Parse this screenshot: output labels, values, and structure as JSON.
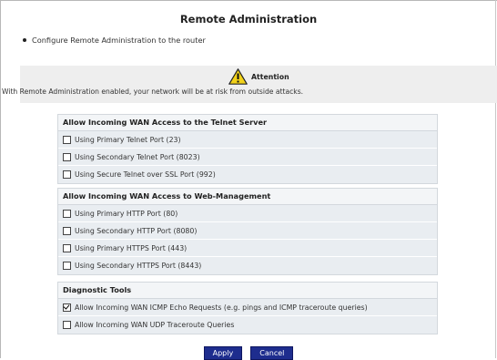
{
  "page": {
    "title": "Remote Administration",
    "intro": "Configure Remote Administration to the router"
  },
  "attention": {
    "title": "Attention",
    "message": "With Remote Administration enabled, your network will be at risk from outside attacks.",
    "icon": "warning-icon"
  },
  "sections": {
    "telnet": {
      "heading": "Allow Incoming WAN Access to the Telnet Server",
      "options": [
        {
          "label": "Using Primary Telnet Port (23)",
          "checked": false
        },
        {
          "label": "Using Secondary Telnet Port (8023)",
          "checked": false
        },
        {
          "label": "Using Secure Telnet over SSL Port (992)",
          "checked": false
        }
      ]
    },
    "web": {
      "heading": "Allow Incoming WAN Access to Web-Management",
      "options": [
        {
          "label": "Using Primary HTTP Port (80)",
          "checked": false
        },
        {
          "label": "Using Secondary HTTP Port (8080)",
          "checked": false
        },
        {
          "label": "Using Primary HTTPS Port (443)",
          "checked": false
        },
        {
          "label": "Using Secondary HTTPS Port (8443)",
          "checked": false
        }
      ]
    },
    "diag": {
      "heading": "Diagnostic Tools",
      "options": [
        {
          "label": "Allow Incoming WAN ICMP Echo Requests (e.g. pings and ICMP traceroute queries)",
          "checked": true
        },
        {
          "label": "Allow Incoming WAN UDP Traceroute Queries",
          "checked": false
        }
      ]
    }
  },
  "actions": {
    "apply": "Apply",
    "cancel": "Cancel"
  },
  "colors": {
    "button_bg": "#1e2d8e",
    "panel_bg": "#e9edf1",
    "attention_bg": "#eeeeee",
    "warning_yellow": "#f2d21a"
  }
}
